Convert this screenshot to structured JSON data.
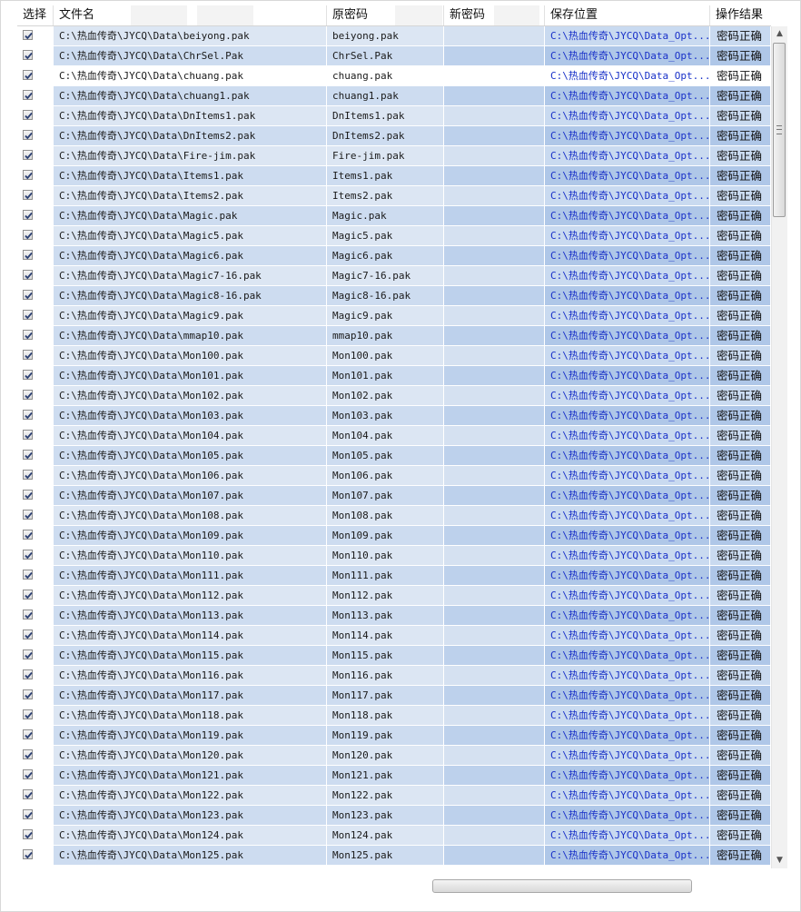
{
  "columns": {
    "select": "选择",
    "filename": "文件名",
    "orig_password": "原密码",
    "new_password": "新密码",
    "save_location": "保存位置",
    "result": "操作结果"
  },
  "rows": [
    {
      "file": "C:\\热血传奇\\JYCQ\\Data\\beiyong.pak",
      "orig": "beiyong.pak",
      "save": "C:\\热血传奇\\JYCQ\\Data_Opt...",
      "result": "密码正确"
    },
    {
      "file": "C:\\热血传奇\\JYCQ\\Data\\ChrSel.Pak",
      "orig": "ChrSel.Pak",
      "save": "C:\\热血传奇\\JYCQ\\Data_Opt...",
      "result": "密码正确"
    },
    {
      "file": "C:\\热血传奇\\JYCQ\\Data\\chuang.pak",
      "orig": "chuang.pak",
      "save": "C:\\热血传奇\\JYCQ\\Data_Opt...",
      "result": "密码正确"
    },
    {
      "file": "C:\\热血传奇\\JYCQ\\Data\\chuang1.pak",
      "orig": "chuang1.pak",
      "save": "C:\\热血传奇\\JYCQ\\Data_Opt...",
      "result": "密码正确"
    },
    {
      "file": "C:\\热血传奇\\JYCQ\\Data\\DnItems1.pak",
      "orig": "DnItems1.pak",
      "save": "C:\\热血传奇\\JYCQ\\Data_Opt...",
      "result": "密码正确"
    },
    {
      "file": "C:\\热血传奇\\JYCQ\\Data\\DnItems2.pak",
      "orig": "DnItems2.pak",
      "save": "C:\\热血传奇\\JYCQ\\Data_Opt...",
      "result": "密码正确"
    },
    {
      "file": "C:\\热血传奇\\JYCQ\\Data\\Fire-jim.pak",
      "orig": "Fire-jim.pak",
      "save": "C:\\热血传奇\\JYCQ\\Data_Opt...",
      "result": "密码正确"
    },
    {
      "file": "C:\\热血传奇\\JYCQ\\Data\\Items1.pak",
      "orig": "Items1.pak",
      "save": "C:\\热血传奇\\JYCQ\\Data_Opt...",
      "result": "密码正确"
    },
    {
      "file": "C:\\热血传奇\\JYCQ\\Data\\Items2.pak",
      "orig": "Items2.pak",
      "save": "C:\\热血传奇\\JYCQ\\Data_Opt...",
      "result": "密码正确"
    },
    {
      "file": "C:\\热血传奇\\JYCQ\\Data\\Magic.pak",
      "orig": "Magic.pak",
      "save": "C:\\热血传奇\\JYCQ\\Data_Opt...",
      "result": "密码正确"
    },
    {
      "file": "C:\\热血传奇\\JYCQ\\Data\\Magic5.pak",
      "orig": "Magic5.pak",
      "save": "C:\\热血传奇\\JYCQ\\Data_Opt...",
      "result": "密码正确"
    },
    {
      "file": "C:\\热血传奇\\JYCQ\\Data\\Magic6.pak",
      "orig": "Magic6.pak",
      "save": "C:\\热血传奇\\JYCQ\\Data_Opt...",
      "result": "密码正确"
    },
    {
      "file": "C:\\热血传奇\\JYCQ\\Data\\Magic7-16.pak",
      "orig": "Magic7-16.pak",
      "save": "C:\\热血传奇\\JYCQ\\Data_Opt...",
      "result": "密码正确"
    },
    {
      "file": "C:\\热血传奇\\JYCQ\\Data\\Magic8-16.pak",
      "orig": "Magic8-16.pak",
      "save": "C:\\热血传奇\\JYCQ\\Data_Opt...",
      "result": "密码正确"
    },
    {
      "file": "C:\\热血传奇\\JYCQ\\Data\\Magic9.pak",
      "orig": "Magic9.pak",
      "save": "C:\\热血传奇\\JYCQ\\Data_Opt...",
      "result": "密码正确"
    },
    {
      "file": "C:\\热血传奇\\JYCQ\\Data\\mmap10.pak",
      "orig": "mmap10.pak",
      "save": "C:\\热血传奇\\JYCQ\\Data_Opt...",
      "result": "密码正确"
    },
    {
      "file": "C:\\热血传奇\\JYCQ\\Data\\Mon100.pak",
      "orig": "Mon100.pak",
      "save": "C:\\热血传奇\\JYCQ\\Data_Opt...",
      "result": "密码正确"
    },
    {
      "file": "C:\\热血传奇\\JYCQ\\Data\\Mon101.pak",
      "orig": "Mon101.pak",
      "save": "C:\\热血传奇\\JYCQ\\Data_Opt...",
      "result": "密码正确"
    },
    {
      "file": "C:\\热血传奇\\JYCQ\\Data\\Mon102.pak",
      "orig": "Mon102.pak",
      "save": "C:\\热血传奇\\JYCQ\\Data_Opt...",
      "result": "密码正确"
    },
    {
      "file": "C:\\热血传奇\\JYCQ\\Data\\Mon103.pak",
      "orig": "Mon103.pak",
      "save": "C:\\热血传奇\\JYCQ\\Data_Opt...",
      "result": "密码正确"
    },
    {
      "file": "C:\\热血传奇\\JYCQ\\Data\\Mon104.pak",
      "orig": "Mon104.pak",
      "save": "C:\\热血传奇\\JYCQ\\Data_Opt...",
      "result": "密码正确"
    },
    {
      "file": "C:\\热血传奇\\JYCQ\\Data\\Mon105.pak",
      "orig": "Mon105.pak",
      "save": "C:\\热血传奇\\JYCQ\\Data_Opt...",
      "result": "密码正确"
    },
    {
      "file": "C:\\热血传奇\\JYCQ\\Data\\Mon106.pak",
      "orig": "Mon106.pak",
      "save": "C:\\热血传奇\\JYCQ\\Data_Opt...",
      "result": "密码正确"
    },
    {
      "file": "C:\\热血传奇\\JYCQ\\Data\\Mon107.pak",
      "orig": "Mon107.pak",
      "save": "C:\\热血传奇\\JYCQ\\Data_Opt...",
      "result": "密码正确"
    },
    {
      "file": "C:\\热血传奇\\JYCQ\\Data\\Mon108.pak",
      "orig": "Mon108.pak",
      "save": "C:\\热血传奇\\JYCQ\\Data_Opt...",
      "result": "密码正确"
    },
    {
      "file": "C:\\热血传奇\\JYCQ\\Data\\Mon109.pak",
      "orig": "Mon109.pak",
      "save": "C:\\热血传奇\\JYCQ\\Data_Opt...",
      "result": "密码正确"
    },
    {
      "file": "C:\\热血传奇\\JYCQ\\Data\\Mon110.pak",
      "orig": "Mon110.pak",
      "save": "C:\\热血传奇\\JYCQ\\Data_Opt...",
      "result": "密码正确"
    },
    {
      "file": "C:\\热血传奇\\JYCQ\\Data\\Mon111.pak",
      "orig": "Mon111.pak",
      "save": "C:\\热血传奇\\JYCQ\\Data_Opt...",
      "result": "密码正确"
    },
    {
      "file": "C:\\热血传奇\\JYCQ\\Data\\Mon112.pak",
      "orig": "Mon112.pak",
      "save": "C:\\热血传奇\\JYCQ\\Data_Opt...",
      "result": "密码正确"
    },
    {
      "file": "C:\\热血传奇\\JYCQ\\Data\\Mon113.pak",
      "orig": "Mon113.pak",
      "save": "C:\\热血传奇\\JYCQ\\Data_Opt...",
      "result": "密码正确"
    },
    {
      "file": "C:\\热血传奇\\JYCQ\\Data\\Mon114.pak",
      "orig": "Mon114.pak",
      "save": "C:\\热血传奇\\JYCQ\\Data_Opt...",
      "result": "密码正确"
    },
    {
      "file": "C:\\热血传奇\\JYCQ\\Data\\Mon115.pak",
      "orig": "Mon115.pak",
      "save": "C:\\热血传奇\\JYCQ\\Data_Opt...",
      "result": "密码正确"
    },
    {
      "file": "C:\\热血传奇\\JYCQ\\Data\\Mon116.pak",
      "orig": "Mon116.pak",
      "save": "C:\\热血传奇\\JYCQ\\Data_Opt...",
      "result": "密码正确"
    },
    {
      "file": "C:\\热血传奇\\JYCQ\\Data\\Mon117.pak",
      "orig": "Mon117.pak",
      "save": "C:\\热血传奇\\JYCQ\\Data_Opt...",
      "result": "密码正确"
    },
    {
      "file": "C:\\热血传奇\\JYCQ\\Data\\Mon118.pak",
      "orig": "Mon118.pak",
      "save": "C:\\热血传奇\\JYCQ\\Data_Opt...",
      "result": "密码正确"
    },
    {
      "file": "C:\\热血传奇\\JYCQ\\Data\\Mon119.pak",
      "orig": "Mon119.pak",
      "save": "C:\\热血传奇\\JYCQ\\Data_Opt...",
      "result": "密码正确"
    },
    {
      "file": "C:\\热血传奇\\JYCQ\\Data\\Mon120.pak",
      "orig": "Mon120.pak",
      "save": "C:\\热血传奇\\JYCQ\\Data_Opt...",
      "result": "密码正确"
    },
    {
      "file": "C:\\热血传奇\\JYCQ\\Data\\Mon121.pak",
      "orig": "Mon121.pak",
      "save": "C:\\热血传奇\\JYCQ\\Data_Opt...",
      "result": "密码正确"
    },
    {
      "file": "C:\\热血传奇\\JYCQ\\Data\\Mon122.pak",
      "orig": "Mon122.pak",
      "save": "C:\\热血传奇\\JYCQ\\Data_Opt...",
      "result": "密码正确"
    },
    {
      "file": "C:\\热血传奇\\JYCQ\\Data\\Mon123.pak",
      "orig": "Mon123.pak",
      "save": "C:\\热血传奇\\JYCQ\\Data_Opt...",
      "result": "密码正确"
    },
    {
      "file": "C:\\热血传奇\\JYCQ\\Data\\Mon124.pak",
      "orig": "Mon124.pak",
      "save": "C:\\热血传奇\\JYCQ\\Data_Opt...",
      "result": "密码正确"
    },
    {
      "file": "C:\\热血传奇\\JYCQ\\Data\\Mon125.pak",
      "orig": "Mon125.pak",
      "save": "C:\\热血传奇\\JYCQ\\Data_Opt...",
      "result": "密码正确"
    }
  ],
  "selected_row": 3,
  "all_checked": true,
  "icons": {
    "checkbox": "checkmark-icon",
    "scroll_up": "scroll-up-arrow-icon",
    "scroll_down": "scroll-down-arrow-icon"
  },
  "colors": {
    "save_path_text": "#1830c8",
    "row_tint": "#cddcf0",
    "row_tint_alt": "#afc7e8"
  }
}
